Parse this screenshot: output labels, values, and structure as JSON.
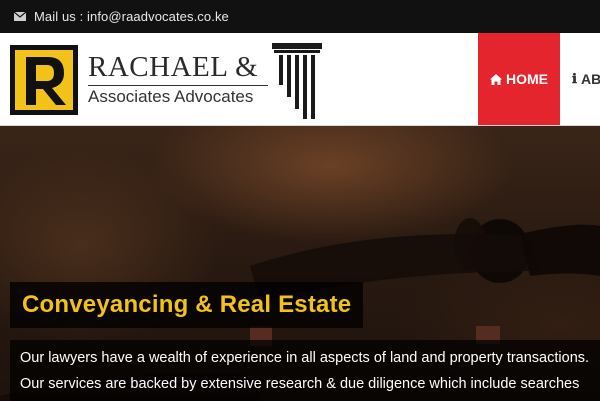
{
  "topbar": {
    "mail_icon": "envelope-icon",
    "mail_text": "Mail us : info@raadvocates.co.ke"
  },
  "logo": {
    "name": "RACHAEL &",
    "subtitle": "Associates Advocates",
    "mark_letter": "R",
    "colors": {
      "mark_yellow": "#f2c21a",
      "mark_black": "#111111"
    }
  },
  "nav": {
    "home_label": "HOME",
    "about_label": "AB",
    "home_icon": "home-icon",
    "about_icon": "info-icon",
    "active_color": "#e4252d"
  },
  "hero": {
    "title": "Conveyancing & Real Estate",
    "line1": "Our lawyers have a wealth of experience in all aspects of land and property transactions.",
    "line2": "Our services are backed by extensive research & due diligence which include searches",
    "colors": {
      "title": "#f2c21a",
      "text": "#ffffff"
    }
  }
}
